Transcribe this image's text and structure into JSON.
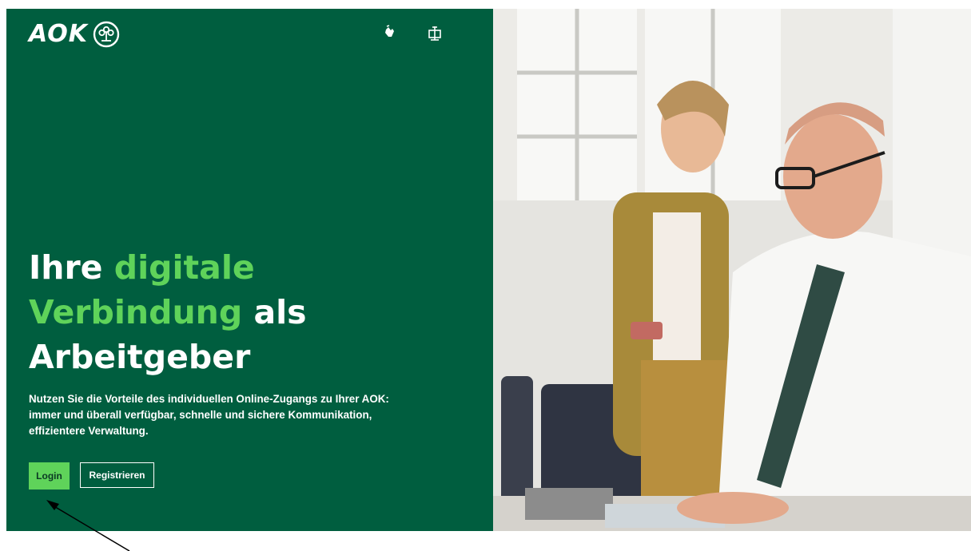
{
  "header": {
    "logo_text": "AOK",
    "logo_icon": "aok-tree-emblem-icon",
    "icons": [
      "sign-language-icon",
      "easy-language-icon"
    ]
  },
  "hero": {
    "headline_part1": "Ihre ",
    "headline_highlight1": "digitale",
    "headline_highlight2": "Verbindung",
    "headline_part2": " als",
    "headline_part3": "Arbeitgeber",
    "lead_line1": "Nutzen Sie die Vorteile des individuellen Online-Zugangs zu Ihrer AOK:",
    "lead_line2": "immer und überall verfügbar, schnelle und sichere Kommunikation,",
    "lead_line3": "effizientere Verwaltung."
  },
  "buttons": {
    "login": "Login",
    "register": "Registrieren"
  },
  "colors": {
    "brand_green": "#005e3f",
    "accent_green": "#5fd35a",
    "text_white": "#ffffff"
  }
}
